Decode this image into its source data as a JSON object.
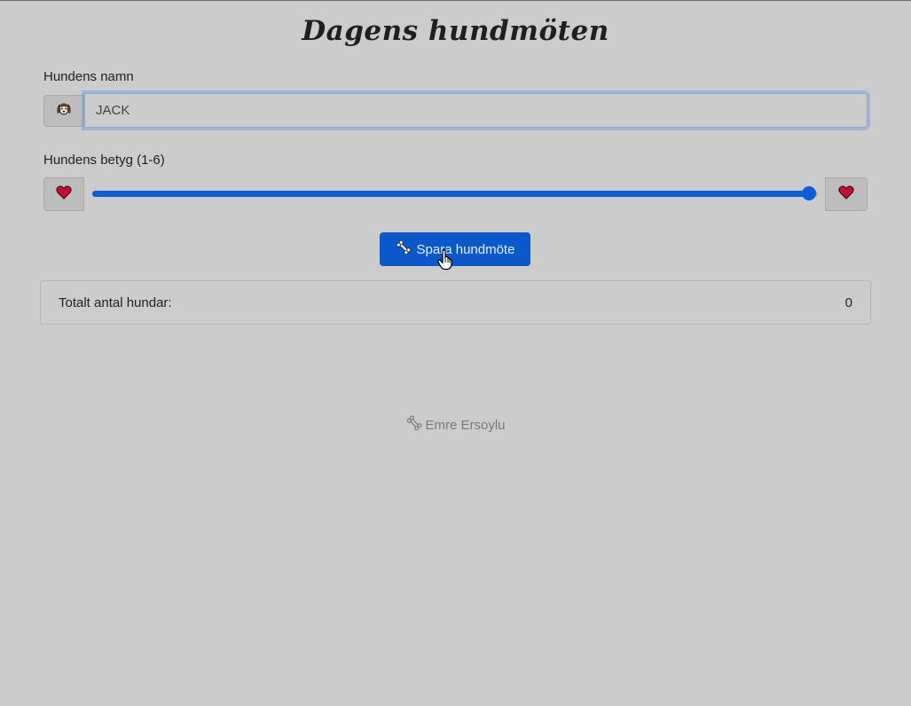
{
  "page": {
    "title": "Dagens hundmöten"
  },
  "name_field": {
    "label": "Hundens namn",
    "value": "JACK",
    "icon": "dog-face-icon"
  },
  "rating": {
    "label": "Hundens betyg (1-6)",
    "min": 1,
    "max": 6,
    "value": 6,
    "left_icon": "heart-icon",
    "right_icon": "heart-icon",
    "accent_color": "#0b5ed7"
  },
  "save_button": {
    "label": "Spara hundmöte",
    "icon": "bone-icon",
    "color": "#0a58ca"
  },
  "summary": {
    "label": "Totalt antal hundar:",
    "count": "0"
  },
  "footer": {
    "icon": "bone-icon",
    "author": "Emre Ersoylu"
  }
}
